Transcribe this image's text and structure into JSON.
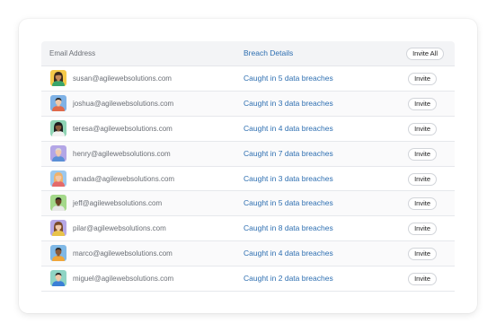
{
  "table": {
    "headers": {
      "email": "Email Address",
      "breach": "Breach Details",
      "invite_all": "Invite All"
    },
    "invite_label": "Invite",
    "rows": [
      {
        "email": "susan@agilewebsolutions.com",
        "breach": "Caught in 5 data breaches",
        "avatar": "avatar-woman-icon",
        "bg": "#f5c94a",
        "skin": "#c68a5a",
        "hair": "#3b2a1f",
        "shirt": "#3aa56a"
      },
      {
        "email": "joshua@agilewebsolutions.com",
        "breach": "Caught in 3 data breaches",
        "avatar": "avatar-man-icon",
        "bg": "#7fb2e6",
        "skin": "#f0c8a8",
        "hair": "#2b2b2b",
        "shirt": "#e06a4a"
      },
      {
        "email": "teresa@agilewebsolutions.com",
        "breach": "Caught in 4 data breaches",
        "avatar": "avatar-woman-icon",
        "bg": "#8fd4b4",
        "skin": "#8a5a3a",
        "hair": "#1e1e1e",
        "shirt": "#f2f2f2"
      },
      {
        "email": "henry@agilewebsolutions.com",
        "breach": "Caught in 7 data breaches",
        "avatar": "avatar-man-icon",
        "bg": "#b3a6e6",
        "skin": "#f1c9ab",
        "hair": "#d9d9d9",
        "shirt": "#5b8fd6"
      },
      {
        "email": "amada@agilewebsolutions.com",
        "breach": "Caught in 3 data breaches",
        "avatar": "avatar-woman-icon",
        "bg": "#9cc8ee",
        "skin": "#f3c8a8",
        "hair": "#f0b26a",
        "shirt": "#e46a6a"
      },
      {
        "email": "jeff@agilewebsolutions.com",
        "breach": "Caught in 5 data breaches",
        "avatar": "avatar-man-icon",
        "bg": "#a4d88a",
        "skin": "#6b4326",
        "hair": "#1e1e1e",
        "shirt": "#e8e8e8"
      },
      {
        "email": "pilar@agilewebsolutions.com",
        "breach": "Caught in 8 data breaches",
        "avatar": "avatar-woman-icon",
        "bg": "#b6a7e6",
        "skin": "#f0c8a8",
        "hair": "#7a4a2a",
        "shirt": "#e8c34a"
      },
      {
        "email": "marco@agilewebsolutions.com",
        "breach": "Caught in 4 data breaches",
        "avatar": "avatar-man-icon",
        "bg": "#7fb8e6",
        "skin": "#8a5a3a",
        "hair": "#2a2a2a",
        "shirt": "#f0a63a"
      },
      {
        "email": "miguel@agilewebsolutions.com",
        "breach": "Caught in 2 data breaches",
        "avatar": "avatar-man-icon",
        "bg": "#8fd4c4",
        "skin": "#f0c8a8",
        "hair": "#2b2b2b",
        "shirt": "#3a7fd6"
      }
    ]
  }
}
